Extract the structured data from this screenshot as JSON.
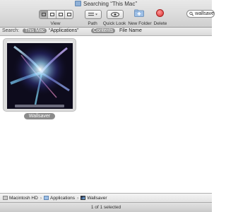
{
  "window": {
    "title": "Searching “This Mac”"
  },
  "toolbar": {
    "view_label": "View",
    "path_label": "Path",
    "quicklook_label": "Quick Look",
    "newfolder_label": "New Folder",
    "delete_label": "Delete",
    "search_value": "wallsave",
    "view_modes": [
      "icon-view-icon",
      "list-view-icon",
      "column-view-icon",
      "coverflow-view-icon"
    ],
    "selected_view": 0
  },
  "scope": {
    "label": "Search:",
    "options": [
      "This Mac",
      "“Applications”"
    ],
    "selected": 0,
    "criteria": [
      "Contents",
      "File Name"
    ],
    "selected_criteria": 0
  },
  "results": [
    {
      "name": "Wallsaver",
      "icon": "wallsaver-thumbnail"
    }
  ],
  "pathbar": {
    "crumbs": [
      "Macintosh HD",
      "Applications",
      "Wallsaver"
    ]
  },
  "status": {
    "text": "1 of 1 selected"
  },
  "colors": {
    "selection_gray": "#8c8c8c",
    "delete_red": "#d92b2b"
  }
}
